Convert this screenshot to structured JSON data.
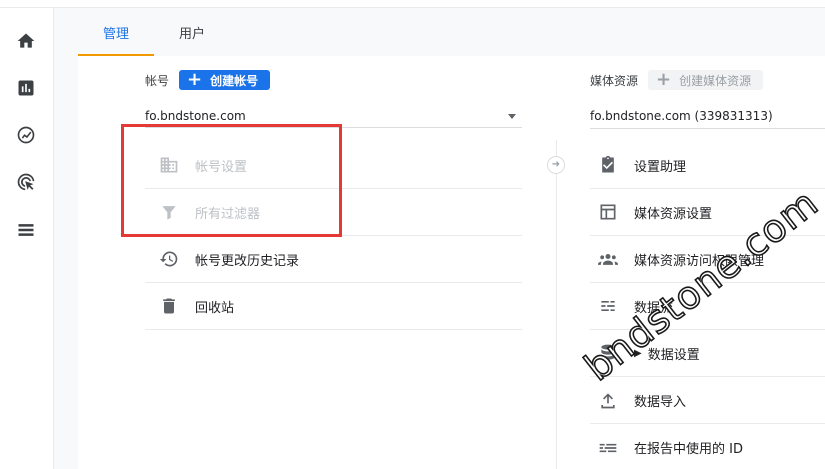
{
  "tabs": [
    {
      "label": "管理",
      "active": true
    },
    {
      "label": "用户",
      "active": false
    }
  ],
  "account": {
    "label": "帐号",
    "create_button": "创建帐号",
    "selected": "fo.bndstone.com",
    "items": [
      {
        "label": "帐号设置",
        "icon": "building-icon",
        "disabled": true
      },
      {
        "label": "所有过滤器",
        "icon": "filter-icon",
        "disabled": true
      },
      {
        "label": "帐号更改历史记录",
        "icon": "history-icon",
        "disabled": false
      },
      {
        "label": "回收站",
        "icon": "trash-icon",
        "disabled": false
      }
    ]
  },
  "property": {
    "label": "媒体资源",
    "create_button": "创建媒体资源",
    "selected": "fo.bndstone.com (339831313)",
    "items": [
      {
        "label": "设置助理",
        "icon": "checklist-icon"
      },
      {
        "label": "媒体资源设置",
        "icon": "layout-icon"
      },
      {
        "label": "媒体资源访问权限管理",
        "icon": "people-icon"
      },
      {
        "label": "数据流",
        "icon": "streams-icon"
      },
      {
        "label": "数据设置",
        "icon": "database-icon"
      },
      {
        "label": "数据导入",
        "icon": "upload-icon"
      },
      {
        "label": "在报告中使用的 ID",
        "icon": "id-icon"
      }
    ]
  },
  "watermark": "bndstone.com",
  "colors": {
    "accent": "#1a73e8",
    "tab_underline": "#f29900",
    "highlight_box": "#e53935"
  }
}
